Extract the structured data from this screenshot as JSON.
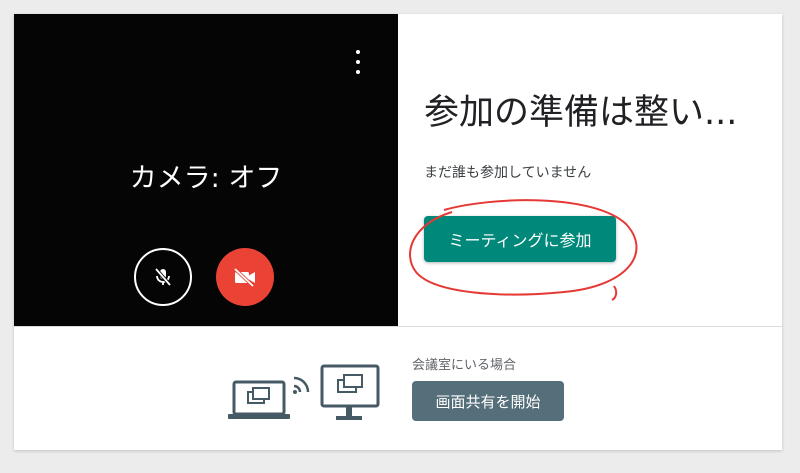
{
  "preview": {
    "camera_status": "カメラ: オフ",
    "more_icon": "more-vert-icon",
    "mic_icon": "mic-off-icon",
    "camera_icon": "videocam-off-icon"
  },
  "join": {
    "title": "参加の準備は整い...",
    "status": "まだ誰も参加していません",
    "button_label": "ミーティングに参加"
  },
  "room": {
    "label": "会議室にいる場合",
    "button_label": "画面共有を開始"
  },
  "colors": {
    "join_button": "#00897b",
    "camera_off_button": "#ea4335",
    "share_button": "#546e7a",
    "annotation": "#e53935"
  }
}
